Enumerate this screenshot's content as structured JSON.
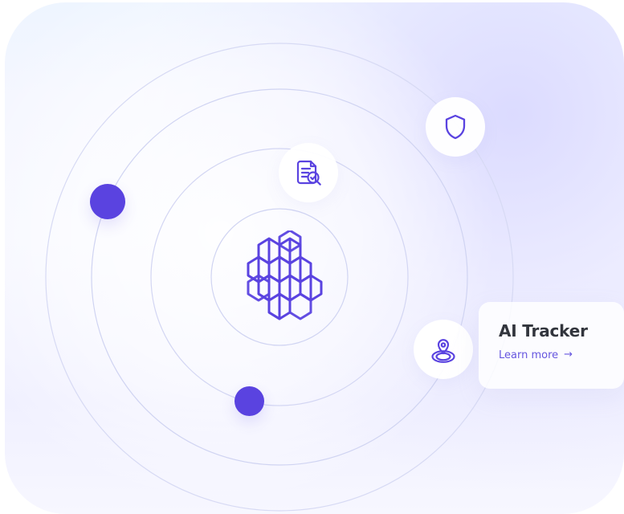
{
  "theme": {
    "accent": "#5a43e0",
    "ring": "#cdd0f3",
    "icon": "#5a43e0"
  },
  "tracker": {
    "title": "AI Tracker",
    "link": "Learn more",
    "arrow": "→"
  },
  "icons": {
    "center": "hexagon-cluster-icon",
    "document": "document-check-icon",
    "shield": "shield-icon",
    "location": "location-pin-icon"
  }
}
